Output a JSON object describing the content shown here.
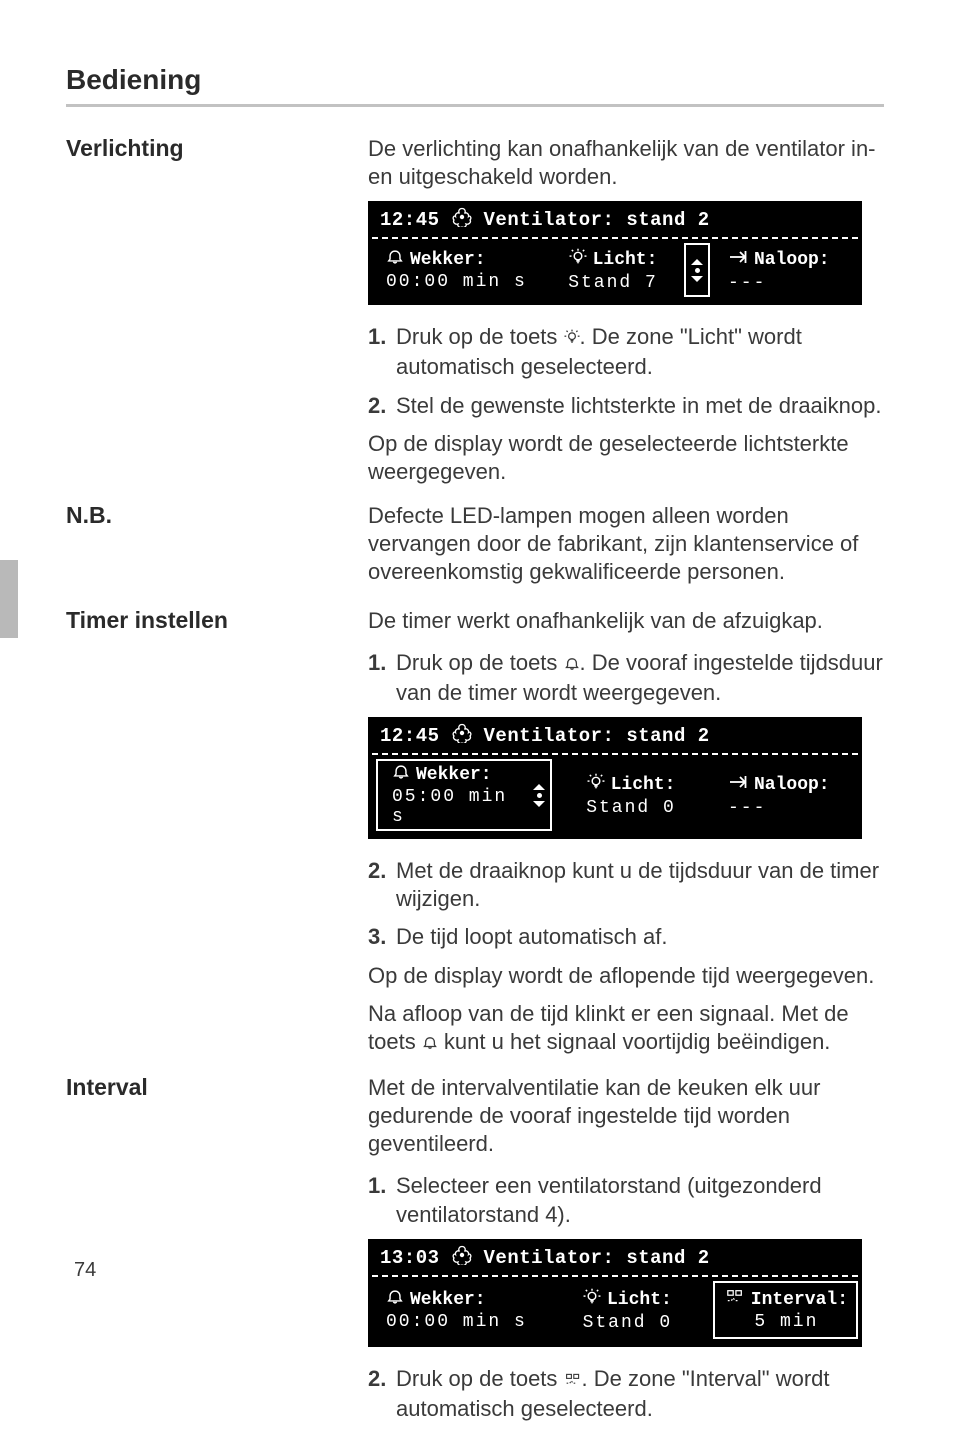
{
  "page": {
    "title": "Bediening",
    "number": "74"
  },
  "icons": {
    "fan": "fan-icon",
    "alarm": "alarm-icon",
    "light": "light-icon",
    "runon": "runon-icon",
    "interval": "interval-icon"
  },
  "sections": {
    "verlichting": {
      "heading": "Verlichting",
      "intro": "De verlichting kan onafhankelijk van de ventilator in- en uitgeschakeld worden.",
      "step1_a": "Druk op de toets ",
      "step1_b": ". De zone \"Licht\" wordt automatisch geselecteerd.",
      "step2": "Stel de gewenste lichtsterkte in met de draaiknop.",
      "after": "Op de display wordt de geselecteerde lichtsterkte weergegeven."
    },
    "nb": {
      "heading": "N.B.",
      "body": "Defecte LED-lampen mogen alleen worden vervangen door de fabrikant, zijn klantenservice of overeenkomstig gekwalificeerde personen."
    },
    "timer": {
      "heading": "Timer instellen",
      "intro": "De timer werkt onafhankelijk van de afzuigkap.",
      "step1_a": "Druk op de toets ",
      "step1_b": ". De vooraf ingestelde tijdsduur van de timer wordt weergegeven.",
      "step2": "Met de draaiknop kunt u de tijdsduur van de timer wijzigen.",
      "step3": "De tijd loopt automatisch af.",
      "after1": "Op de display wordt de aflopende tijd weergegeven.",
      "after2_a": "Na afloop van de tijd klinkt er een signaal. Met de toets ",
      "after2_b": " kunt u het signaal voortijdig beëindigen."
    },
    "interval": {
      "heading": "Interval",
      "intro": "Met de intervalventilatie kan de keuken elk uur gedurende de vooraf ingestelde tijd worden geventileerd.",
      "step1": "Selecteer een ventilatorstand (uitgezonderd ventilatorstand 4).",
      "step2_a": "Druk op de toets ",
      "step2_b": ". De zone \"Interval\" wordt automatisch geselecteerd."
    }
  },
  "lcd_common": {
    "wekker_label": "Wekker:",
    "licht_label": "Licht:",
    "naloop_label": "Naloop:",
    "interval_label": "Interval:",
    "naloop_val_dashes": "---"
  },
  "lcd1": {
    "time": "12:45",
    "top": "Ventilator: stand 2",
    "wekker_val": "00:00 min s",
    "licht_val": "Stand 7"
  },
  "lcd2": {
    "time": "12:45",
    "top": "Ventilator: stand 2",
    "wekker_val": "05:00 min s",
    "licht_val": "Stand 0"
  },
  "lcd3": {
    "time": "13:03",
    "top": "Ventilator: stand 2",
    "wekker_val": "00:00 min s",
    "licht_val": "Stand 0",
    "interval_val": "5  min"
  }
}
